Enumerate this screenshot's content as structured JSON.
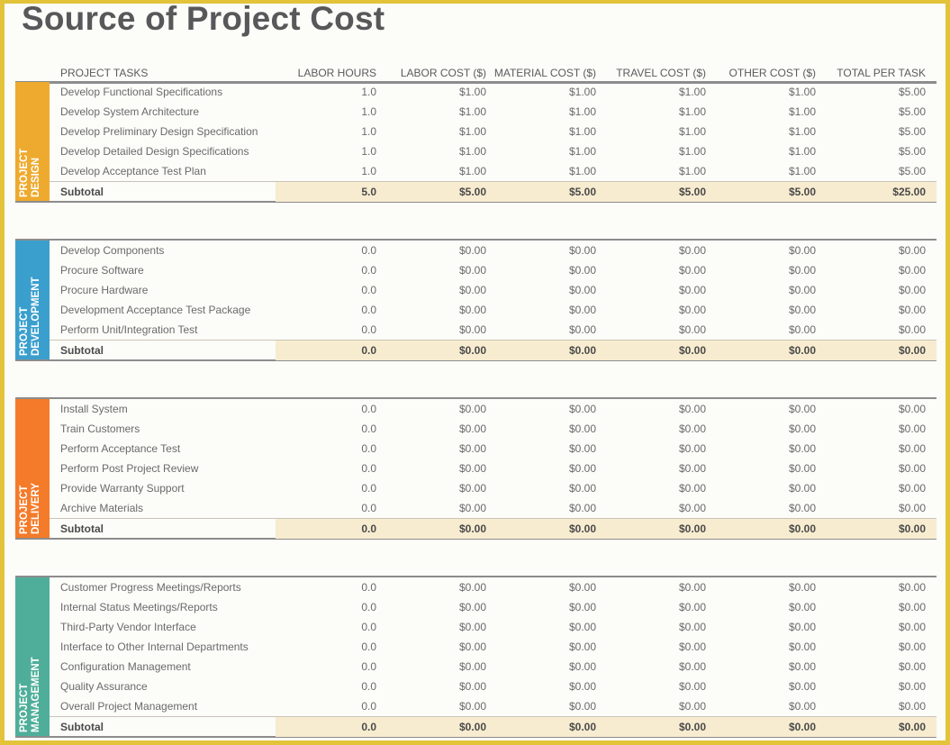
{
  "title": "Source of Project Cost",
  "columns": {
    "task": "PROJECT TASKS",
    "labor_hours": "LABOR HOURS",
    "labor_cost": "LABOR COST ($)",
    "material_cost": "MATERIAL COST ($)",
    "travel_cost": "TRAVEL COST ($)",
    "other_cost": "OTHER COST ($)",
    "total": "TOTAL PER TASK"
  },
  "colors": {
    "page_border": "#e2c33a",
    "design": "#eeaa2e",
    "development": "#3b9fcd",
    "delivery": "#f47b2a",
    "management": "#4fae9a",
    "subtotal_bg": "#f8ecd0"
  },
  "sections": [
    {
      "label_line1": "PROJECT",
      "label_line2": "DESIGN",
      "rows": [
        {
          "task": "Develop Functional Specifications",
          "hours": "1.0",
          "labor": "$1.00",
          "material": "$1.00",
          "travel": "$1.00",
          "other": "$1.00",
          "total": "$5.00"
        },
        {
          "task": "Develop System Architecture",
          "hours": "1.0",
          "labor": "$1.00",
          "material": "$1.00",
          "travel": "$1.00",
          "other": "$1.00",
          "total": "$5.00"
        },
        {
          "task": "Develop Preliminary Design Specification",
          "hours": "1.0",
          "labor": "$1.00",
          "material": "$1.00",
          "travel": "$1.00",
          "other": "$1.00",
          "total": "$5.00"
        },
        {
          "task": "Develop Detailed Design Specifications",
          "hours": "1.0",
          "labor": "$1.00",
          "material": "$1.00",
          "travel": "$1.00",
          "other": "$1.00",
          "total": "$5.00"
        },
        {
          "task": "Develop Acceptance Test Plan",
          "hours": "1.0",
          "labor": "$1.00",
          "material": "$1.00",
          "travel": "$1.00",
          "other": "$1.00",
          "total": "$5.00"
        }
      ],
      "subtotal": {
        "label": "Subtotal",
        "hours": "5.0",
        "labor": "$5.00",
        "material": "$5.00",
        "travel": "$5.00",
        "other": "$5.00",
        "total": "$25.00"
      }
    },
    {
      "label_line1": "PROJECT",
      "label_line2": "DEVELOPMENT",
      "rows": [
        {
          "task": "Develop Components",
          "hours": "0.0",
          "labor": "$0.00",
          "material": "$0.00",
          "travel": "$0.00",
          "other": "$0.00",
          "total": "$0.00"
        },
        {
          "task": "Procure Software",
          "hours": "0.0",
          "labor": "$0.00",
          "material": "$0.00",
          "travel": "$0.00",
          "other": "$0.00",
          "total": "$0.00"
        },
        {
          "task": "Procure Hardware",
          "hours": "0.0",
          "labor": "$0.00",
          "material": "$0.00",
          "travel": "$0.00",
          "other": "$0.00",
          "total": "$0.00"
        },
        {
          "task": "Development Acceptance Test Package",
          "hours": "0.0",
          "labor": "$0.00",
          "material": "$0.00",
          "travel": "$0.00",
          "other": "$0.00",
          "total": "$0.00"
        },
        {
          "task": "Perform Unit/Integration Test",
          "hours": "0.0",
          "labor": "$0.00",
          "material": "$0.00",
          "travel": "$0.00",
          "other": "$0.00",
          "total": "$0.00"
        }
      ],
      "subtotal": {
        "label": "Subtotal",
        "hours": "0.0",
        "labor": "$0.00",
        "material": "$0.00",
        "travel": "$0.00",
        "other": "$0.00",
        "total": "$0.00"
      }
    },
    {
      "label_line1": "PROJECT",
      "label_line2": "DELIVERY",
      "rows": [
        {
          "task": "Install System",
          "hours": "0.0",
          "labor": "$0.00",
          "material": "$0.00",
          "travel": "$0.00",
          "other": "$0.00",
          "total": "$0.00"
        },
        {
          "task": "Train Customers",
          "hours": "0.0",
          "labor": "$0.00",
          "material": "$0.00",
          "travel": "$0.00",
          "other": "$0.00",
          "total": "$0.00"
        },
        {
          "task": "Perform Acceptance Test",
          "hours": "0.0",
          "labor": "$0.00",
          "material": "$0.00",
          "travel": "$0.00",
          "other": "$0.00",
          "total": "$0.00"
        },
        {
          "task": "Perform Post Project Review",
          "hours": "0.0",
          "labor": "$0.00",
          "material": "$0.00",
          "travel": "$0.00",
          "other": "$0.00",
          "total": "$0.00"
        },
        {
          "task": "Provide Warranty Support",
          "hours": "0.0",
          "labor": "$0.00",
          "material": "$0.00",
          "travel": "$0.00",
          "other": "$0.00",
          "total": "$0.00"
        },
        {
          "task": "Archive Materials",
          "hours": "0.0",
          "labor": "$0.00",
          "material": "$0.00",
          "travel": "$0.00",
          "other": "$0.00",
          "total": "$0.00"
        }
      ],
      "subtotal": {
        "label": "Subtotal",
        "hours": "0.0",
        "labor": "$0.00",
        "material": "$0.00",
        "travel": "$0.00",
        "other": "$0.00",
        "total": "$0.00"
      }
    },
    {
      "label_line1": "PROJECT",
      "label_line2": "MANAGEMENT",
      "rows": [
        {
          "task": "Customer Progress Meetings/Reports",
          "hours": "0.0",
          "labor": "$0.00",
          "material": "$0.00",
          "travel": "$0.00",
          "other": "$0.00",
          "total": "$0.00"
        },
        {
          "task": "Internal Status Meetings/Reports",
          "hours": "0.0",
          "labor": "$0.00",
          "material": "$0.00",
          "travel": "$0.00",
          "other": "$0.00",
          "total": "$0.00"
        },
        {
          "task": "Third-Party Vendor Interface",
          "hours": "0.0",
          "labor": "$0.00",
          "material": "$0.00",
          "travel": "$0.00",
          "other": "$0.00",
          "total": "$0.00"
        },
        {
          "task": "Interface to Other Internal Departments",
          "hours": "0.0",
          "labor": "$0.00",
          "material": "$0.00",
          "travel": "$0.00",
          "other": "$0.00",
          "total": "$0.00"
        },
        {
          "task": "Configuration Management",
          "hours": "0.0",
          "labor": "$0.00",
          "material": "$0.00",
          "travel": "$0.00",
          "other": "$0.00",
          "total": "$0.00"
        },
        {
          "task": "Quality Assurance",
          "hours": "0.0",
          "labor": "$0.00",
          "material": "$0.00",
          "travel": "$0.00",
          "other": "$0.00",
          "total": "$0.00"
        },
        {
          "task": "Overall Project Management",
          "hours": "0.0",
          "labor": "$0.00",
          "material": "$0.00",
          "travel": "$0.00",
          "other": "$0.00",
          "total": "$0.00"
        }
      ],
      "subtotal": {
        "label": "Subtotal",
        "hours": "0.0",
        "labor": "$0.00",
        "material": "$0.00",
        "travel": "$0.00",
        "other": "$0.00",
        "total": "$0.00"
      }
    }
  ]
}
